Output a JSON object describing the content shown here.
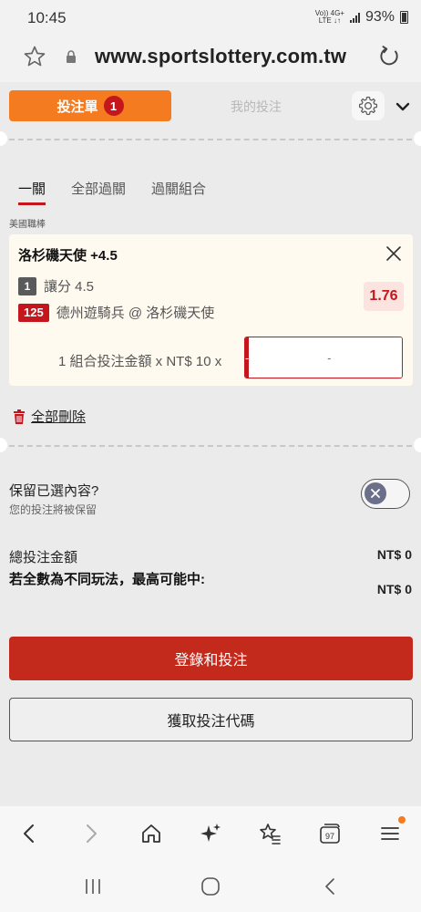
{
  "status_bar": {
    "time": "10:45",
    "network_top": "Vo)) 4G+",
    "network_bottom": "LTE ↓↑",
    "battery": "93%"
  },
  "url_bar": {
    "url": "www.sportslottery.com.tw"
  },
  "header": {
    "betslip_tab": "投注單",
    "betslip_count": "1",
    "mybets_tab": "我的投注"
  },
  "sub_tabs": {
    "single": "一關",
    "all_parlay": "全部過關",
    "parlay_combo": "過關組合"
  },
  "league": "美國職棒",
  "bet": {
    "title": "洛杉磯天使 +4.5",
    "market_number": "1",
    "market": "讓分 4.5",
    "match_number": "125",
    "match": "德州遊騎兵 @ 洛杉磯天使",
    "odds": "1.76",
    "stake_label": "1 組合投注金額 x NT$ 10 x",
    "minus": "-",
    "stake_placeholder": "-",
    "plus": "+"
  },
  "delete_all": "全部刪除",
  "keep_selections": {
    "title": "保留已選內容?",
    "subtitle": "您的投注將被保留"
  },
  "totals": {
    "total_label": "總投注金額",
    "total_value": "NT$ 0",
    "max_win_label": "若全數為不同玩法，最高可能中:",
    "max_win_value": "NT$ 0"
  },
  "buttons": {
    "login_and_bet": "登錄和投注",
    "get_code": "獲取投注代碼"
  },
  "browser_nav": {
    "tabs_count": "97"
  },
  "colors": {
    "accent_orange": "#f47b1f",
    "accent_red": "#c4161c",
    "login_button": "#c32a1c"
  }
}
